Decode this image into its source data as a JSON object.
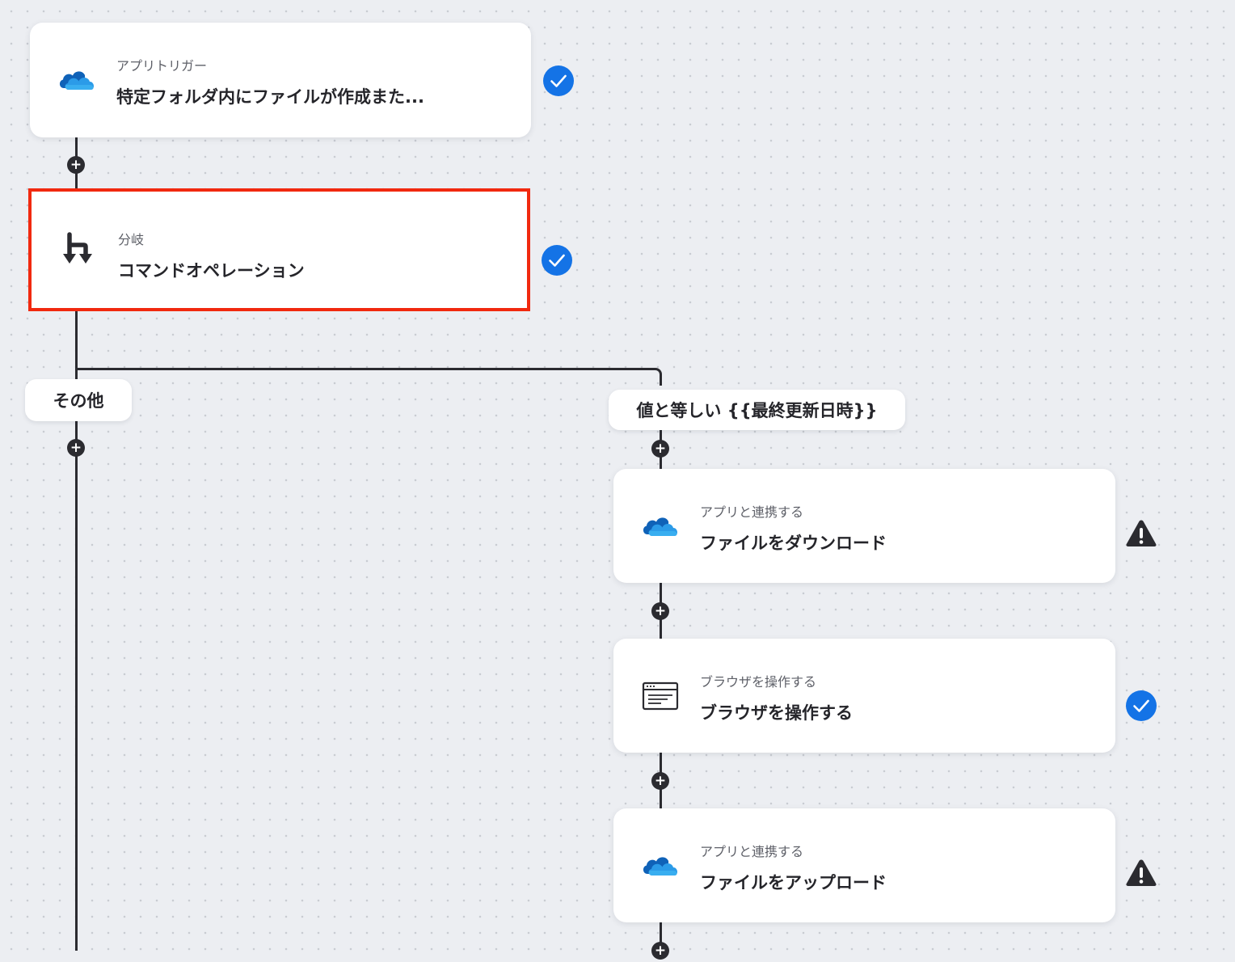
{
  "colors": {
    "background": "#eceef2",
    "connector": "#2b2b30",
    "check_blue": "#1473e6",
    "selection_red": "#f1290f",
    "warning_dark": "#2b2b30",
    "onedrive_blue": "#0f6cbd"
  },
  "nodes": {
    "trigger": {
      "subtitle": "アプリトリガー",
      "title": "特定フォルダ内にファイルが作成また...",
      "icon": "onedrive-icon",
      "status": "complete"
    },
    "branch": {
      "subtitle": "分岐",
      "title": "コマンドオペレーション",
      "icon": "branch-icon",
      "status": "complete",
      "selected": true
    },
    "download": {
      "subtitle": "アプリと連携する",
      "title": "ファイルをダウンロード",
      "icon": "onedrive-icon",
      "status": "warning"
    },
    "browser": {
      "subtitle": "ブラウザを操作する",
      "title": "ブラウザを操作する",
      "icon": "browser-window-icon",
      "status": "complete"
    },
    "upload": {
      "subtitle": "アプリと連携する",
      "title": "ファイルをアップロード",
      "icon": "onedrive-icon",
      "status": "warning"
    }
  },
  "branches": {
    "other": {
      "label": "その他"
    },
    "equals": {
      "label": "値と等しい {{最終更新日時}}"
    }
  },
  "add_step": {
    "symbol": "+"
  }
}
